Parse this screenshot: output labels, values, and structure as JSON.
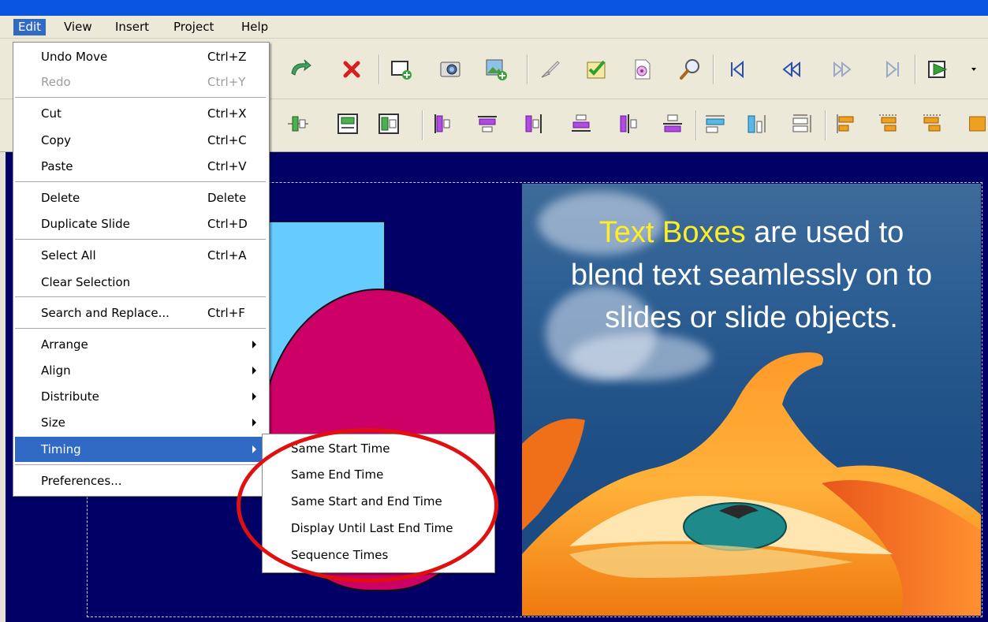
{
  "menubar": {
    "items": [
      {
        "label": "Edit",
        "active": true
      },
      {
        "label": "View"
      },
      {
        "label": "Insert"
      },
      {
        "label": "Project"
      },
      {
        "label": "Help"
      }
    ]
  },
  "edit_menu": {
    "items": [
      {
        "label": "Undo Move",
        "shortcut": "Ctrl+Z"
      },
      {
        "label": "Redo",
        "shortcut": "Ctrl+Y",
        "disabled": true
      },
      {
        "label": "Cut",
        "shortcut": "Ctrl+X"
      },
      {
        "label": "Copy",
        "shortcut": "Ctrl+C"
      },
      {
        "label": "Paste",
        "shortcut": "Ctrl+V"
      },
      {
        "label": "Delete",
        "shortcut": "Delete"
      },
      {
        "label": "Duplicate Slide",
        "shortcut": "Ctrl+D"
      },
      {
        "label": "Select All",
        "shortcut": "Ctrl+A"
      },
      {
        "label": "Clear Selection",
        "shortcut": ""
      },
      {
        "label": "Search and Replace...",
        "shortcut": "Ctrl+F"
      },
      {
        "label": "Arrange",
        "submenu": true
      },
      {
        "label": "Align",
        "submenu": true
      },
      {
        "label": "Distribute",
        "submenu": true
      },
      {
        "label": "Size",
        "submenu": true
      },
      {
        "label": "Timing",
        "submenu": true,
        "selected": true
      },
      {
        "label": "Preferences...",
        "shortcut": ""
      }
    ]
  },
  "timing_submenu": {
    "items": [
      {
        "label": "Same Start Time"
      },
      {
        "label": "Same End Time"
      },
      {
        "label": "Same Start and End Time"
      },
      {
        "label": "Display Until Last End Time"
      },
      {
        "label": "Sequence Times"
      }
    ]
  },
  "slide": {
    "text_highlight": "Text Boxes",
    "text_line1_rest": " are used to",
    "text_line2": "blend text seamlessly on to",
    "text_line3": "slides or slide objects."
  },
  "colors": {
    "canvas_bg": "#000066",
    "menu_highlight": "#316ac5",
    "annotation_circle": "#e01010",
    "cyan_shape": "#66ccff",
    "pink_shape": "#cc0066",
    "text_highlight": "#ffee22"
  },
  "toolbar_icons": {
    "row1": [
      "rotate-icon",
      "delete-icon",
      "add-slide-icon",
      "camera-icon",
      "insert-image-icon",
      "brush-icon",
      "checklist-icon",
      "properties-icon",
      "zoom-icon",
      "first-slide-icon",
      "rewind-icon",
      "forward-icon",
      "last-slide-icon",
      "play-icon"
    ],
    "row2": [
      "align-center-v-icon",
      "align-middle-icon",
      "align-center-box-icon",
      "align-left-icon",
      "align-top-icon",
      "align-right-icon",
      "align-bottom-icon",
      "align-vcenter-icon",
      "align-hcenter-icon",
      "distribute-h-icon",
      "distribute-v-icon",
      "distribute-spacing-icon",
      "size-width-icon",
      "size-height-icon",
      "size-both-icon"
    ]
  }
}
